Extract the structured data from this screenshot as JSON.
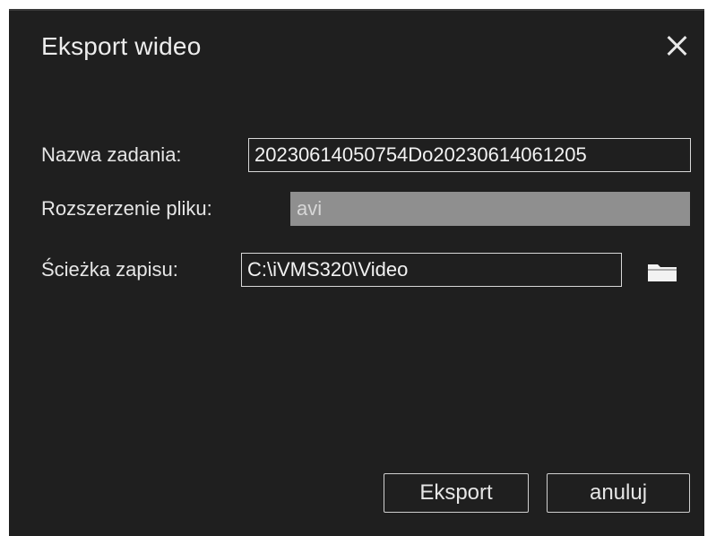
{
  "dialog": {
    "title": "Eksport wideo",
    "close_icon": "close-icon"
  },
  "form": {
    "task_name_label": "Nazwa zadania:",
    "task_name_value": "20230614050754Do20230614061205",
    "extension_label": "Rozszerzenie pliku:",
    "extension_value": "avi",
    "save_path_label": "Ścieżka zapisu:",
    "save_path_value": "C:\\iVMS320\\Video",
    "browse_icon": "folder-icon"
  },
  "buttons": {
    "export_label": "Eksport",
    "cancel_label": "anuluj"
  },
  "colors": {
    "dialog_background": "#1f1f1f",
    "disabled_field": "#8f8f8f",
    "text": "#e6e6e6",
    "border": "#d8d8d8"
  }
}
